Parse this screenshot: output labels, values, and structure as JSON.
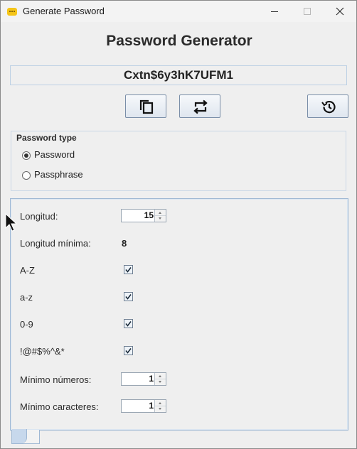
{
  "window": {
    "title": "Generate Password",
    "icon": "password-app-icon"
  },
  "app": {
    "heading": "Password Generator",
    "generated_password": "Cxtn$6y3hK7UFM1"
  },
  "toolbar": {
    "buttons": [
      {
        "name": "copy-button",
        "icon": "copy-icon"
      },
      {
        "name": "regenerate-button",
        "icon": "refresh-icon"
      },
      {
        "name": "history-button",
        "icon": "history-icon"
      }
    ]
  },
  "password_type": {
    "title": "Password type",
    "options": [
      {
        "label": "Password",
        "checked": true
      },
      {
        "label": "Passphrase",
        "checked": false
      }
    ]
  },
  "settings": {
    "length": {
      "label": "Longitud:",
      "value": "15"
    },
    "min_length": {
      "label": "Longitud mínima:",
      "value": "8"
    },
    "uppercase": {
      "label": "A-Z",
      "checked": true
    },
    "lowercase": {
      "label": "a-z",
      "checked": true
    },
    "digits": {
      "label": "0-9",
      "checked": true
    },
    "special": {
      "label": "!@#$%^&*",
      "checked": true
    },
    "min_numbers": {
      "label": "Mínimo números:",
      "value": "1"
    },
    "min_special": {
      "label": "Mínimo caracteres:",
      "value": "1"
    }
  },
  "colors": {
    "accent_border": "#9fb8d4",
    "background": "#efefef"
  }
}
